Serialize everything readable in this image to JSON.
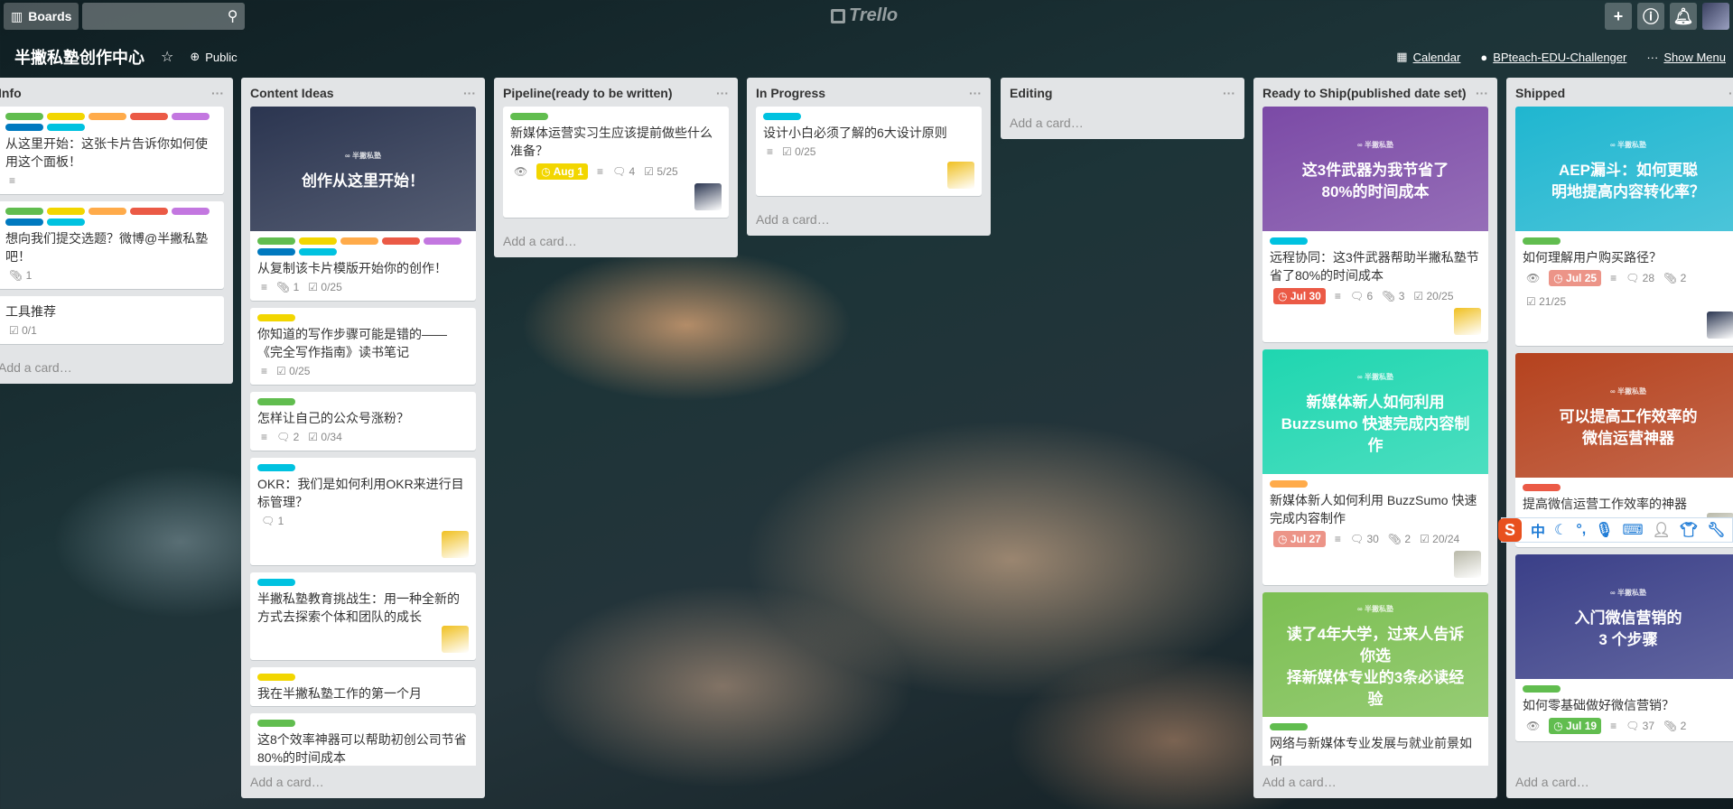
{
  "topbar": {
    "boards_label": "Boards",
    "search_placeholder": "",
    "logo": "Trello",
    "icons": [
      "plus-icon",
      "info-icon",
      "bell-icon"
    ]
  },
  "board": {
    "title": "半撇私塾创作中心",
    "visibility": "Public",
    "calendar": "Calendar",
    "github": "BPteach-EDU-Challenger",
    "menu": "Show Menu"
  },
  "add_card": "Add a card…",
  "lists": [
    {
      "title": "Info",
      "cards": [
        {
          "labels": [
            "#61bd4f",
            "#f2d600",
            "#ffab4a",
            "#eb5a46",
            "#c377e0",
            "#0079bf",
            "#00c2e0"
          ],
          "title": "从这里开始：这张卡片告诉你如何使用这个面板！",
          "badges": {
            "desc": true
          }
        },
        {
          "labels": [
            "#61bd4f",
            "#f2d600",
            "#ffab4a",
            "#eb5a46",
            "#c377e0",
            "#0079bf",
            "#00c2e0"
          ],
          "title": "想向我们提交选题？微博@半撇私塾吧！",
          "badges": {
            "attachments": "1"
          }
        },
        {
          "labels": [],
          "title": "工具推荐",
          "badges": {
            "checklist": "0/1"
          }
        }
      ]
    },
    {
      "title": "Content Ideas",
      "cards": [
        {
          "cover": {
            "color": "#2b3550",
            "text": "创作从这里开始！"
          },
          "labels": [
            "#61bd4f",
            "#f2d600",
            "#ffab4a",
            "#eb5a46",
            "#c377e0",
            "#0079bf",
            "#00c2e0"
          ],
          "title": "从复制该卡片模版开始你的创作！",
          "badges": {
            "desc": true,
            "attachments": "1",
            "checklist": "0/25"
          }
        },
        {
          "labels": [
            "#f2d600"
          ],
          "title": "你知道的写作步骤可能是错的——《完全写作指南》读书笔记",
          "badges": {
            "desc": true,
            "checklist": "0/25"
          }
        },
        {
          "labels": [
            "#61bd4f"
          ],
          "title": "怎样让自己的公众号涨粉？",
          "badges": {
            "desc": true,
            "comments": "2",
            "checklist": "0/34"
          }
        },
        {
          "labels": [
            "#00c2e0"
          ],
          "title": "OKR：我们是如何利用OKR来进行目标管理？",
          "badges": {
            "comments": "1"
          },
          "avatar": "#f0c020"
        },
        {
          "labels": [
            "#00c2e0"
          ],
          "title": "半撇私塾教育挑战生：用一种全新的方式去探索个体和团队的成长",
          "badges": {},
          "avatar": "#f0c020"
        },
        {
          "labels": [
            "#f2d600"
          ],
          "title": "我在半撇私塾工作的第一个月",
          "badges": {}
        },
        {
          "labels": [
            "#61bd4f"
          ],
          "title": "这8个效率神器可以帮助初创公司节省80%的时间成本",
          "badges": {}
        }
      ]
    },
    {
      "title": "Pipeline(ready to be written)",
      "cards": [
        {
          "labels": [
            "#61bd4f"
          ],
          "title": "新媒体运营实习生应该提前做些什么准备？",
          "badges": {
            "watch": true,
            "due": {
              "text": "Aug 1",
              "color": "#f2d600"
            },
            "desc": true,
            "comments": "4",
            "checklist": "5/25"
          },
          "avatar": "#2a3550"
        }
      ]
    },
    {
      "title": "In Progress",
      "cards": [
        {
          "labels": [
            "#00c2e0"
          ],
          "title": "设计小白必须了解的6大设计原则",
          "badges": {
            "desc": true,
            "checklist": "0/25"
          },
          "avatar": "#f0c020"
        }
      ]
    },
    {
      "title": "Editing",
      "cards": []
    },
    {
      "title": "Ready to Ship(published date set)",
      "cards": [
        {
          "cover": {
            "color": "#7b4aa6",
            "text": "这3件武器为我节省了\n80%的时间成本"
          },
          "labels": [
            "#00c2e0"
          ],
          "title": "远程协同：这3件武器帮助半撇私塾节省了80%的时间成本",
          "badges": {
            "due": {
              "text": "Jul 30",
              "color": "#eb5a46"
            },
            "desc": true,
            "comments": "6",
            "attachments": "3",
            "checklist": "20/25"
          },
          "avatar": "#f0c020"
        },
        {
          "cover": {
            "color": "#1fd6b0",
            "text": "新媒体新人如何利用\nBuzzsumo 快速完成内容制作"
          },
          "labels": [
            "#ffab4a"
          ],
          "title": "新媒体新人如何利用 BuzzSumo 快速完成内容制作",
          "badges": {
            "due": {
              "text": "Jul 27",
              "color": "#ec9488"
            },
            "desc": true,
            "comments": "30",
            "attachments": "2",
            "checklist": "20/24"
          },
          "avatar": "#b8b8a8"
        },
        {
          "cover": {
            "color": "#7cbf52",
            "text": "读了4年大学，过来人告诉你选\n择新媒体专业的3条必读经验"
          },
          "labels": [
            "#61bd4f"
          ],
          "title": "网络与新媒体专业发展与就业前景如何",
          "badges": {}
        }
      ]
    },
    {
      "title": "Shipped",
      "cards": [
        {
          "cover": {
            "color": "#1fb6d0",
            "text": "AEP漏斗：如何更聪\n明地提高内容转化率？"
          },
          "labels": [
            "#61bd4f"
          ],
          "title": "如何理解用户购买路径？",
          "badges": {
            "watch": true,
            "due": {
              "text": "Jul 25",
              "color": "#ec9488"
            },
            "desc": true,
            "comments": "28",
            "attachments": "2",
            "checklist": "21/25"
          },
          "avatar": "#2a3550"
        },
        {
          "cover": {
            "color": "#b5421e",
            "text": "可以提高工作效率的\n微信运营神器"
          },
          "labels": [
            "#eb5a46"
          ],
          "title": "提高微信运营工作效率的神器",
          "badges": {},
          "avatar": "#b8b8a8"
        },
        {
          "cover": {
            "color": "#3a3f88",
            "text": "入门微信营销的\n3 个步骤"
          },
          "labels": [
            "#61bd4f"
          ],
          "title": "如何零基础做好微信营销？",
          "badges": {
            "watch": true,
            "due": {
              "text": "Jul 19",
              "color": "#61bd4f"
            },
            "desc": true,
            "comments": "37",
            "attachments": "2"
          }
        }
      ]
    }
  ],
  "ime": {
    "mode": "中",
    "icons": [
      "moon-icon",
      "punctuation-icon",
      "mic-icon",
      "keyboard-icon",
      "user-icon",
      "shirt-icon",
      "wrench-icon"
    ]
  }
}
